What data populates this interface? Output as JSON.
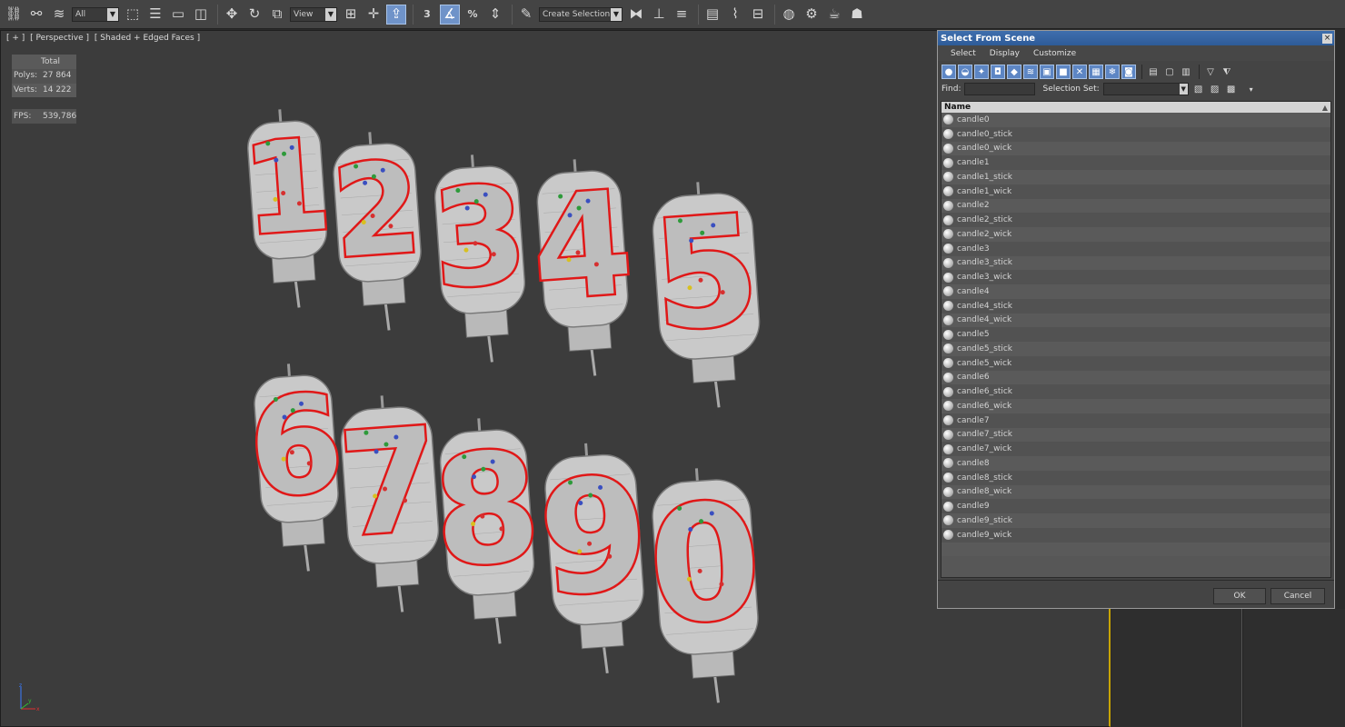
{
  "toolbar": {
    "selection_filter": "All",
    "reference_coordinate": "View",
    "snap_angle_label": "3",
    "percent_snap_label": "%",
    "named_selection_placeholder": "Create Selection Se",
    "icons": [
      "link-icon",
      "unlink-icon",
      "bind-spacewarp-icon",
      "select-object-icon",
      "select-by-name-icon",
      "rectangular-region-icon",
      "window-crossing-icon",
      "move-icon",
      "rotate-icon",
      "scale-icon",
      "pivot-icon",
      "select-manipulate-icon",
      "keyboard-shortcut-icon",
      "snap-toggle-icon",
      "angle-snap-icon",
      "percent-snap-icon",
      "spinner-snap-icon",
      "edit-named-selection-icon",
      "mirror-icon",
      "align-icon",
      "layer-manager-icon",
      "scene-explorer-icon",
      "curve-editor-icon",
      "schematic-view-icon",
      "material-editor-icon",
      "render-setup-icon",
      "rendered-frame-icon",
      "render-icon"
    ]
  },
  "viewport": {
    "labels": [
      "[ + ]",
      "[ Perspective ]",
      "[ Shaded + Edged Faces ]"
    ],
    "stats": {
      "header": "Total",
      "polys_label": "Polys:",
      "polys_value": "27 864",
      "verts_label": "Verts:",
      "verts_value": "14 222",
      "fps_label": "FPS:",
      "fps_value": "539,786"
    },
    "candles_row1": [
      "1",
      "2",
      "3",
      "4",
      "5"
    ],
    "candles_row2": [
      "6",
      "7",
      "8",
      "9",
      "0"
    ],
    "axis": {
      "x": "x",
      "y": "y",
      "z": "z"
    }
  },
  "dialog": {
    "title": "Select From Scene",
    "close_glyph": "×",
    "menu": [
      "Select",
      "Display",
      "Customize"
    ],
    "find_label": "Find:",
    "find_value": "",
    "selection_set_label": "Selection Set:",
    "selection_set_value": "",
    "column_header": "Name",
    "sort_glyph": "▲",
    "objects": [
      "candle0",
      "candle0_stick",
      "candle0_wick",
      "candle1",
      "candle1_stick",
      "candle1_wick",
      "candle2",
      "candle2_stick",
      "candle2_wick",
      "candle3",
      "candle3_stick",
      "candle3_wick",
      "candle4",
      "candle4_stick",
      "candle4_wick",
      "candle5",
      "candle5_stick",
      "candle5_wick",
      "candle6",
      "candle6_stick",
      "candle6_wick",
      "candle7",
      "candle7_stick",
      "candle7_wick",
      "candle8",
      "candle8_stick",
      "candle8_wick",
      "candle9",
      "candle9_stick",
      "candle9_wick"
    ],
    "ok_label": "OK",
    "cancel_label": "Cancel"
  },
  "colors": {
    "viewport_bg": "#3c3c3c",
    "candle_body": "#c9c9c9",
    "candle_outline": "#e01818",
    "stats_text": "#e8d200",
    "title_bar": "#2e5b98",
    "active_button": "#6f93c9"
  }
}
